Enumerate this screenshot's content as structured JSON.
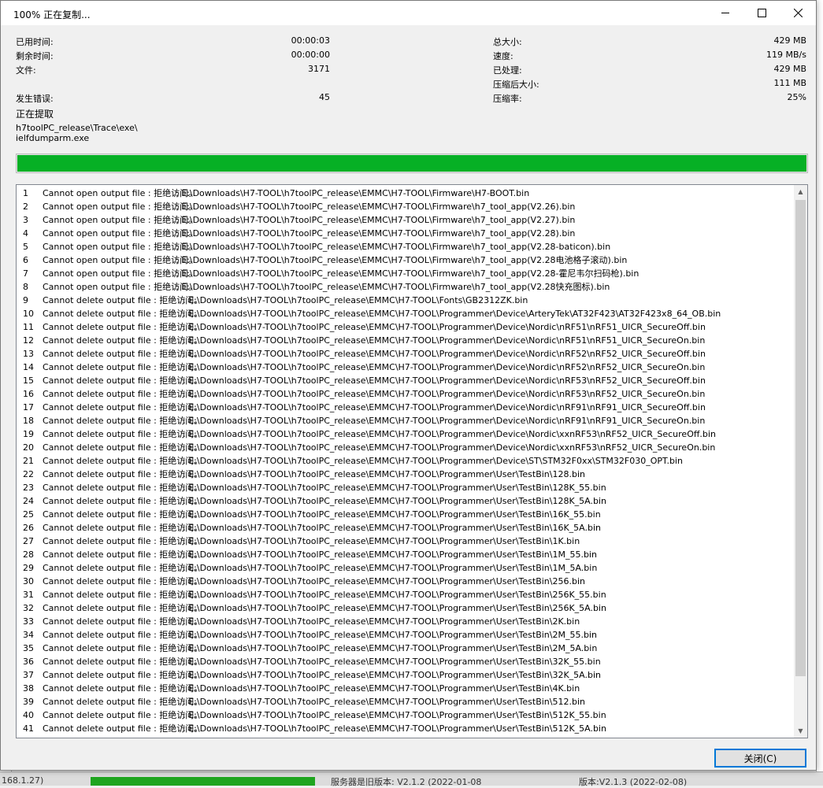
{
  "window": {
    "title": "100% 正在复制...",
    "controls": {
      "minimize": "minimize-icon",
      "maximize": "maximize-icon",
      "close": "close-icon"
    }
  },
  "stats_left": [
    {
      "label": "已用时间:",
      "value": "00:00:03"
    },
    {
      "label": "剩余时间:",
      "value": "00:00:00"
    },
    {
      "label": "文件:",
      "value": "3171"
    },
    {
      "label": "发生错误:",
      "value": "45"
    }
  ],
  "stats_right": [
    {
      "label": "总大小:",
      "value": "429 MB"
    },
    {
      "label": "速度:",
      "value": "119 MB/s"
    },
    {
      "label": "已处理:",
      "value": "429 MB"
    },
    {
      "label": "压缩后大小:",
      "value": "111 MB"
    },
    {
      "label": "压缩率:",
      "value": "25%"
    }
  ],
  "current_action": "正在提取",
  "current_path": "h7toolPC_release\\Trace\\exe\\",
  "current_file": "ielfdumparm.exe",
  "progress": {
    "percent": 100,
    "color": "#06b025"
  },
  "log": {
    "rows": [
      {
        "num": "1",
        "msg": "Cannot open output file : 拒绝访问。",
        "path": ": E:\\Downloads\\H7-TOOL\\h7toolPC_release\\EMMC\\H7-TOOL\\Firmware\\H7-BOOT.bin"
      },
      {
        "num": "2",
        "msg": "Cannot open output file : 拒绝访问。",
        "path": ": E:\\Downloads\\H7-TOOL\\h7toolPC_release\\EMMC\\H7-TOOL\\Firmware\\h7_tool_app(V2.26).bin"
      },
      {
        "num": "3",
        "msg": "Cannot open output file : 拒绝访问。",
        "path": ": E:\\Downloads\\H7-TOOL\\h7toolPC_release\\EMMC\\H7-TOOL\\Firmware\\h7_tool_app(V2.27).bin"
      },
      {
        "num": "4",
        "msg": "Cannot open output file : 拒绝访问。",
        "path": ": E:\\Downloads\\H7-TOOL\\h7toolPC_release\\EMMC\\H7-TOOL\\Firmware\\h7_tool_app(V2.28).bin"
      },
      {
        "num": "5",
        "msg": "Cannot open output file : 拒绝访问。",
        "path": ": E:\\Downloads\\H7-TOOL\\h7toolPC_release\\EMMC\\H7-TOOL\\Firmware\\h7_tool_app(V2.28-baticon).bin"
      },
      {
        "num": "6",
        "msg": "Cannot open output file : 拒绝访问。",
        "path": ": E:\\Downloads\\H7-TOOL\\h7toolPC_release\\EMMC\\H7-TOOL\\Firmware\\h7_tool_app(V2.28电池格子滚动).bin"
      },
      {
        "num": "7",
        "msg": "Cannot open output file : 拒绝访问。",
        "path": ": E:\\Downloads\\H7-TOOL\\h7toolPC_release\\EMMC\\H7-TOOL\\Firmware\\h7_tool_app(V2.28-霍尼韦尔扫码枪).bin"
      },
      {
        "num": "8",
        "msg": "Cannot open output file : 拒绝访问。",
        "path": ": E:\\Downloads\\H7-TOOL\\h7toolPC_release\\EMMC\\H7-TOOL\\Firmware\\h7_tool_app(V2.28快充图标).bin"
      },
      {
        "num": "9",
        "msg": "Cannot delete output file : 拒绝访问。",
        "path": ": E:\\Downloads\\H7-TOOL\\h7toolPC_release\\EMMC\\H7-TOOL\\Fonts\\GB2312ZK.bin"
      },
      {
        "num": "10",
        "msg": "Cannot delete output file : 拒绝访问。",
        "path": ": E:\\Downloads\\H7-TOOL\\h7toolPC_release\\EMMC\\H7-TOOL\\Programmer\\Device\\ArteryTek\\AT32F423\\AT32F423x8_64_OB.bin"
      },
      {
        "num": "11",
        "msg": "Cannot delete output file : 拒绝访问。",
        "path": ": E:\\Downloads\\H7-TOOL\\h7toolPC_release\\EMMC\\H7-TOOL\\Programmer\\Device\\Nordic\\nRF51\\nRF51_UICR_SecureOff.bin"
      },
      {
        "num": "12",
        "msg": "Cannot delete output file : 拒绝访问。",
        "path": ": E:\\Downloads\\H7-TOOL\\h7toolPC_release\\EMMC\\H7-TOOL\\Programmer\\Device\\Nordic\\nRF51\\nRF51_UICR_SecureOn.bin"
      },
      {
        "num": "13",
        "msg": "Cannot delete output file : 拒绝访问。",
        "path": ": E:\\Downloads\\H7-TOOL\\h7toolPC_release\\EMMC\\H7-TOOL\\Programmer\\Device\\Nordic\\nRF52\\nRF52_UICR_SecureOff.bin"
      },
      {
        "num": "14",
        "msg": "Cannot delete output file : 拒绝访问。",
        "path": ": E:\\Downloads\\H7-TOOL\\h7toolPC_release\\EMMC\\H7-TOOL\\Programmer\\Device\\Nordic\\nRF52\\nRF52_UICR_SecureOn.bin"
      },
      {
        "num": "15",
        "msg": "Cannot delete output file : 拒绝访问。",
        "path": ": E:\\Downloads\\H7-TOOL\\h7toolPC_release\\EMMC\\H7-TOOL\\Programmer\\Device\\Nordic\\nRF53\\nRF52_UICR_SecureOff.bin"
      },
      {
        "num": "16",
        "msg": "Cannot delete output file : 拒绝访问。",
        "path": ": E:\\Downloads\\H7-TOOL\\h7toolPC_release\\EMMC\\H7-TOOL\\Programmer\\Device\\Nordic\\nRF53\\nRF52_UICR_SecureOn.bin"
      },
      {
        "num": "17",
        "msg": "Cannot delete output file : 拒绝访问。",
        "path": ": E:\\Downloads\\H7-TOOL\\h7toolPC_release\\EMMC\\H7-TOOL\\Programmer\\Device\\Nordic\\nRF91\\nRF91_UICR_SecureOff.bin"
      },
      {
        "num": "18",
        "msg": "Cannot delete output file : 拒绝访问。",
        "path": ": E:\\Downloads\\H7-TOOL\\h7toolPC_release\\EMMC\\H7-TOOL\\Programmer\\Device\\Nordic\\nRF91\\nRF91_UICR_SecureOn.bin"
      },
      {
        "num": "19",
        "msg": "Cannot delete output file : 拒绝访问。",
        "path": ": E:\\Downloads\\H7-TOOL\\h7toolPC_release\\EMMC\\H7-TOOL\\Programmer\\Device\\Nordic\\xxnRF53\\nRF52_UICR_SecureOff.bin"
      },
      {
        "num": "20",
        "msg": "Cannot delete output file : 拒绝访问。",
        "path": ": E:\\Downloads\\H7-TOOL\\h7toolPC_release\\EMMC\\H7-TOOL\\Programmer\\Device\\Nordic\\xxnRF53\\nRF52_UICR_SecureOn.bin"
      },
      {
        "num": "21",
        "msg": "Cannot delete output file : 拒绝访问。",
        "path": ": E:\\Downloads\\H7-TOOL\\h7toolPC_release\\EMMC\\H7-TOOL\\Programmer\\Device\\ST\\STM32F0xx\\STM32F030_OPT.bin"
      },
      {
        "num": "22",
        "msg": "Cannot delete output file : 拒绝访问。",
        "path": ": E:\\Downloads\\H7-TOOL\\h7toolPC_release\\EMMC\\H7-TOOL\\Programmer\\User\\TestBin\\128.bin"
      },
      {
        "num": "23",
        "msg": "Cannot delete output file : 拒绝访问。",
        "path": ": E:\\Downloads\\H7-TOOL\\h7toolPC_release\\EMMC\\H7-TOOL\\Programmer\\User\\TestBin\\128K_55.bin"
      },
      {
        "num": "24",
        "msg": "Cannot delete output file : 拒绝访问。",
        "path": ": E:\\Downloads\\H7-TOOL\\h7toolPC_release\\EMMC\\H7-TOOL\\Programmer\\User\\TestBin\\128K_5A.bin"
      },
      {
        "num": "25",
        "msg": "Cannot delete output file : 拒绝访问。",
        "path": ": E:\\Downloads\\H7-TOOL\\h7toolPC_release\\EMMC\\H7-TOOL\\Programmer\\User\\TestBin\\16K_55.bin"
      },
      {
        "num": "26",
        "msg": "Cannot delete output file : 拒绝访问。",
        "path": ": E:\\Downloads\\H7-TOOL\\h7toolPC_release\\EMMC\\H7-TOOL\\Programmer\\User\\TestBin\\16K_5A.bin"
      },
      {
        "num": "27",
        "msg": "Cannot delete output file : 拒绝访问。",
        "path": ": E:\\Downloads\\H7-TOOL\\h7toolPC_release\\EMMC\\H7-TOOL\\Programmer\\User\\TestBin\\1K.bin"
      },
      {
        "num": "28",
        "msg": "Cannot delete output file : 拒绝访问。",
        "path": ": E:\\Downloads\\H7-TOOL\\h7toolPC_release\\EMMC\\H7-TOOL\\Programmer\\User\\TestBin\\1M_55.bin"
      },
      {
        "num": "29",
        "msg": "Cannot delete output file : 拒绝访问。",
        "path": ": E:\\Downloads\\H7-TOOL\\h7toolPC_release\\EMMC\\H7-TOOL\\Programmer\\User\\TestBin\\1M_5A.bin"
      },
      {
        "num": "30",
        "msg": "Cannot delete output file : 拒绝访问。",
        "path": ": E:\\Downloads\\H7-TOOL\\h7toolPC_release\\EMMC\\H7-TOOL\\Programmer\\User\\TestBin\\256.bin"
      },
      {
        "num": "31",
        "msg": "Cannot delete output file : 拒绝访问。",
        "path": ": E:\\Downloads\\H7-TOOL\\h7toolPC_release\\EMMC\\H7-TOOL\\Programmer\\User\\TestBin\\256K_55.bin"
      },
      {
        "num": "32",
        "msg": "Cannot delete output file : 拒绝访问。",
        "path": ": E:\\Downloads\\H7-TOOL\\h7toolPC_release\\EMMC\\H7-TOOL\\Programmer\\User\\TestBin\\256K_5A.bin"
      },
      {
        "num": "33",
        "msg": "Cannot delete output file : 拒绝访问。",
        "path": ": E:\\Downloads\\H7-TOOL\\h7toolPC_release\\EMMC\\H7-TOOL\\Programmer\\User\\TestBin\\2K.bin"
      },
      {
        "num": "34",
        "msg": "Cannot delete output file : 拒绝访问。",
        "path": ": E:\\Downloads\\H7-TOOL\\h7toolPC_release\\EMMC\\H7-TOOL\\Programmer\\User\\TestBin\\2M_55.bin"
      },
      {
        "num": "35",
        "msg": "Cannot delete output file : 拒绝访问。",
        "path": ": E:\\Downloads\\H7-TOOL\\h7toolPC_release\\EMMC\\H7-TOOL\\Programmer\\User\\TestBin\\2M_5A.bin"
      },
      {
        "num": "36",
        "msg": "Cannot delete output file : 拒绝访问。",
        "path": ": E:\\Downloads\\H7-TOOL\\h7toolPC_release\\EMMC\\H7-TOOL\\Programmer\\User\\TestBin\\32K_55.bin"
      },
      {
        "num": "37",
        "msg": "Cannot delete output file : 拒绝访问。",
        "path": ": E:\\Downloads\\H7-TOOL\\h7toolPC_release\\EMMC\\H7-TOOL\\Programmer\\User\\TestBin\\32K_5A.bin"
      },
      {
        "num": "38",
        "msg": "Cannot delete output file : 拒绝访问。",
        "path": ": E:\\Downloads\\H7-TOOL\\h7toolPC_release\\EMMC\\H7-TOOL\\Programmer\\User\\TestBin\\4K.bin"
      },
      {
        "num": "39",
        "msg": "Cannot delete output file : 拒绝访问。",
        "path": ": E:\\Downloads\\H7-TOOL\\h7toolPC_release\\EMMC\\H7-TOOL\\Programmer\\User\\TestBin\\512.bin"
      },
      {
        "num": "40",
        "msg": "Cannot delete output file : 拒绝访问。",
        "path": ": E:\\Downloads\\H7-TOOL\\h7toolPC_release\\EMMC\\H7-TOOL\\Programmer\\User\\TestBin\\512K_55.bin"
      },
      {
        "num": "41",
        "msg": "Cannot delete output file : 拒绝访问。",
        "path": ": E:\\Downloads\\H7-TOOL\\h7toolPC_release\\EMMC\\H7-TOOL\\Programmer\\User\\TestBin\\512K_5A.bin"
      }
    ]
  },
  "close_button_label": "关闭(C)",
  "background": {
    "bottom_left": "168.1.27)",
    "bottom_mid": "服务器是旧版本: V2.1.2 (2022-01-08",
    "bottom_right": "版本:V2.1.3 (2022-02-08)"
  }
}
